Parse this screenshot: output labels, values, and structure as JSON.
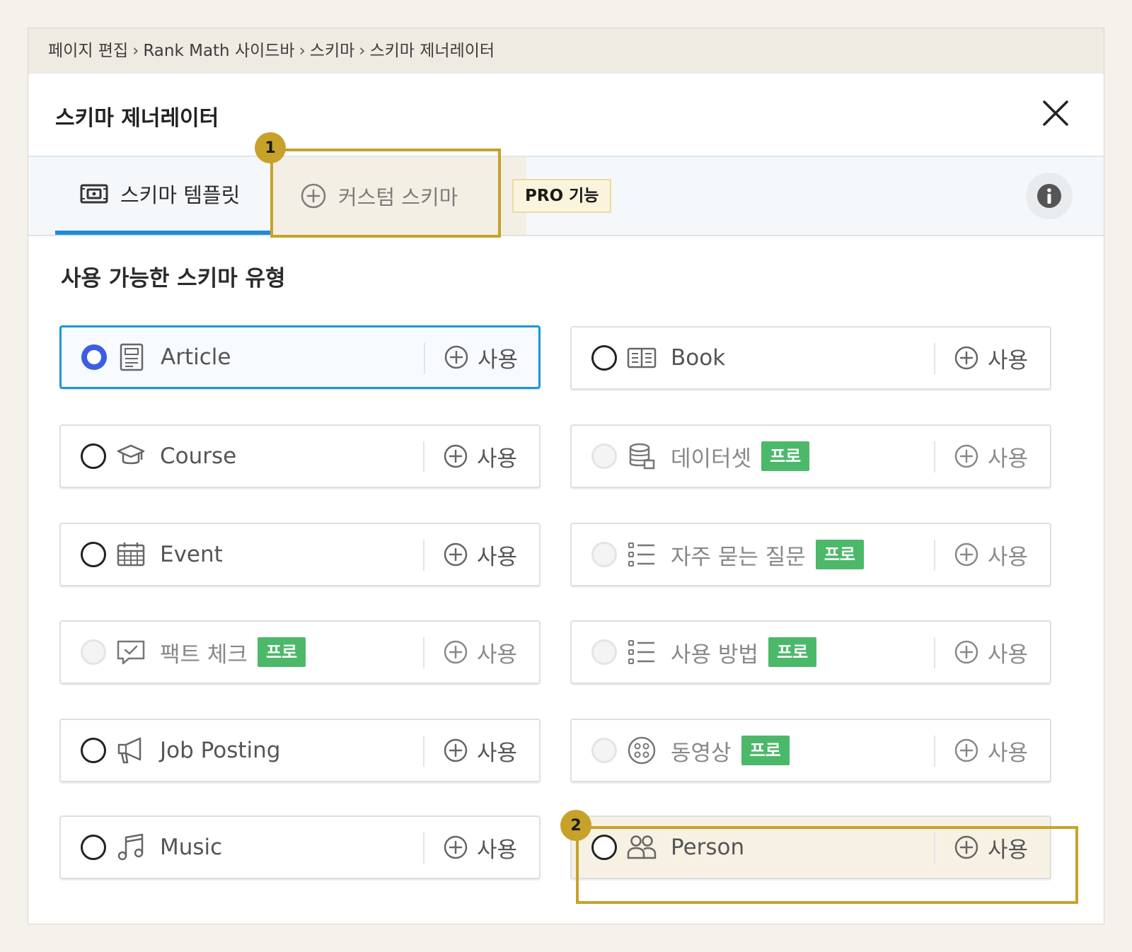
{
  "breadcrumb": [
    "페이지 편집",
    "Rank Math 사이드바",
    "스키마",
    "스키마 제너레이터"
  ],
  "breadcrumb_sep": "›",
  "modal": {
    "title": "스키마 제너레이터",
    "close_icon": "close-icon"
  },
  "tabs": {
    "template": "스키마 템플릿",
    "custom": "커스텀 스키마",
    "pro_badge": "PRO 기능"
  },
  "markers": {
    "one": "1",
    "two": "2"
  },
  "section_title": "사용 가능한 스키마 유형",
  "use_label": "사용",
  "pro_tag": "프로",
  "schemas": {
    "article": {
      "label": "Article",
      "icon": "document-icon"
    },
    "book": {
      "label": "Book",
      "icon": "book-icon"
    },
    "course": {
      "label": "Course",
      "icon": "graduation-cap-icon"
    },
    "dataset": {
      "label": "데이터셋",
      "icon": "database-icon"
    },
    "event": {
      "label": "Event",
      "icon": "calendar-icon"
    },
    "faq": {
      "label": "자주 묻는 질문",
      "icon": "list-icon"
    },
    "factcheck": {
      "label": "팩트 체크",
      "icon": "chat-check-icon"
    },
    "howto": {
      "label": "사용 방법",
      "icon": "list-icon"
    },
    "job": {
      "label": "Job Posting",
      "icon": "megaphone-icon"
    },
    "video": {
      "label": "동영상",
      "icon": "film-reel-icon"
    },
    "music": {
      "label": "Music",
      "icon": "music-note-icon"
    },
    "person": {
      "label": "Person",
      "icon": "users-icon"
    }
  },
  "colors": {
    "accent_blue": "#1e95dc",
    "radio_selected": "#3c5ee0",
    "pro_green": "#4cb86a",
    "highlight_gold": "#c7a22a"
  }
}
